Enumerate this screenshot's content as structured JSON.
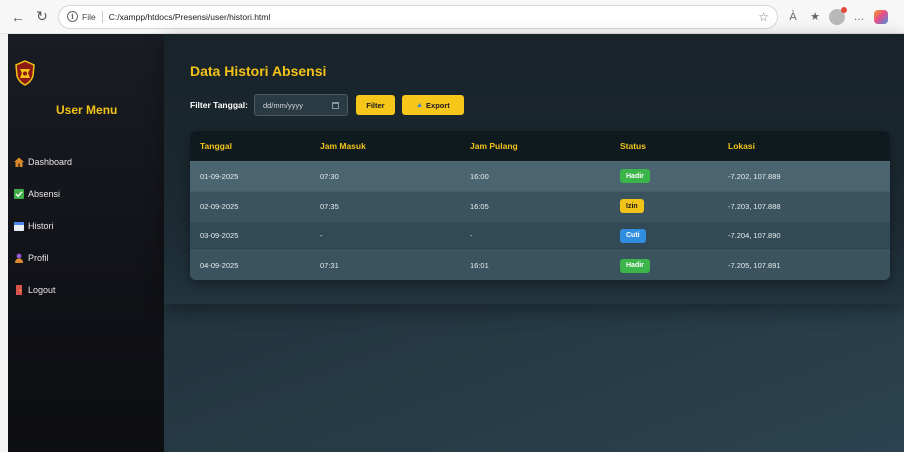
{
  "browser": {
    "file_label": "File",
    "url": "C:/xampp/htdocs/Presensi/user/histori.html",
    "more_label": "…"
  },
  "sidebar": {
    "title": "User Menu",
    "items": [
      {
        "label": "Dashboard",
        "icon": "house-icon",
        "color": "#d98b2b"
      },
      {
        "label": "Absensi",
        "icon": "check-box-icon",
        "color": "#3fae49"
      },
      {
        "label": "Histori",
        "icon": "calendar-icon",
        "color": "#4a86e8"
      },
      {
        "label": "Profil",
        "icon": "person-icon",
        "color": "#8e5bd6"
      },
      {
        "label": "Logout",
        "icon": "door-icon",
        "color": "#d9534f"
      }
    ]
  },
  "main": {
    "title": "Data Histori Absensi",
    "filter_label": "Filter Tanggal:",
    "date_placeholder": "dd/mm/yyyy",
    "filter_button": "Filter",
    "export_button": "Export"
  },
  "table": {
    "headers": [
      "Tanggal",
      "Jam Masuk",
      "Jam Pulang",
      "Status",
      "Lokasi"
    ],
    "rows": [
      {
        "tanggal": "01-09-2025",
        "masuk": "07:30",
        "pulang": "16:00",
        "status": "Hadir",
        "status_color": "#3bb54a",
        "lokasi": "-7.202, 107.889"
      },
      {
        "tanggal": "02-09-2025",
        "masuk": "07:35",
        "pulang": "16:05",
        "status": "Izin",
        "status_color": "#f2c318",
        "lokasi": "-7.203, 107.888"
      },
      {
        "tanggal": "03-09-2025",
        "masuk": "-",
        "pulang": "-",
        "status": "Cuti",
        "status_color": "#2f8ee0",
        "lokasi": "-7.204, 107.890"
      },
      {
        "tanggal": "04-09-2025",
        "masuk": "07:31",
        "pulang": "16:01",
        "status": "Hadir",
        "status_color": "#3bb54a",
        "lokasi": "-7.205, 107.891"
      }
    ]
  },
  "colors": {
    "accent": "#f2c318",
    "button": "#f7c61a"
  }
}
